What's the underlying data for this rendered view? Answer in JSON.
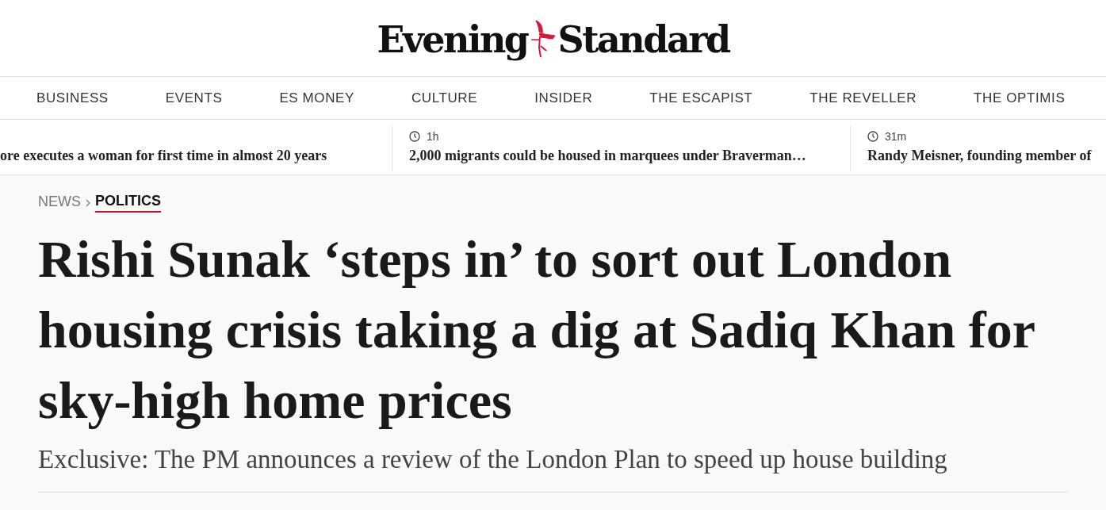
{
  "logo": {
    "left": "Evening",
    "right": "Standard"
  },
  "nav": [
    "BUSINESS",
    "EVENTS",
    "ES MONEY",
    "CULTURE",
    "INSIDER",
    "THE ESCAPIST",
    "THE REVELLER",
    "THE OPTIMIS"
  ],
  "ticker": [
    {
      "headline": "ore executes a woman for first time in almost 20 years"
    },
    {
      "time": "1h",
      "headline": "2,000 migrants could be housed in marquees under Braverman…"
    },
    {
      "time": "31m",
      "headline": "Randy Meisner, founding member of"
    }
  ],
  "breadcrumb": [
    {
      "label": "NEWS",
      "selected": false
    },
    {
      "label": "POLITICS",
      "selected": true
    }
  ],
  "headline": "Rishi Sunak ‘steps in’ to sort out London housing crisis taking a dig at Sadiq Khan for sky-high home prices",
  "standfirst": "Exclusive: The PM announces a review of the London Plan to speed up house building"
}
